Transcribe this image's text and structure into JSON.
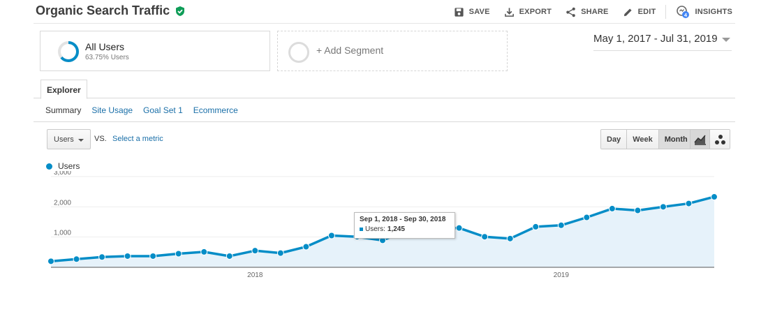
{
  "header": {
    "title": "Organic Search Traffic",
    "actions": [
      {
        "label": "SAVE",
        "icon": "save-icon"
      },
      {
        "label": "EXPORT",
        "icon": "export-icon"
      },
      {
        "label": "SHARE",
        "icon": "share-icon"
      },
      {
        "label": "EDIT",
        "icon": "edit-icon"
      },
      {
        "label": "INSIGHTS",
        "icon": "insights-icon",
        "badge": "4"
      }
    ]
  },
  "segments": {
    "active": {
      "name": "All Users",
      "share": "63.75% Users"
    },
    "add_label": "+ Add Segment"
  },
  "date_range": "May 1, 2017 - Jul 31, 2019",
  "tabs": {
    "main": "Explorer",
    "sub": [
      "Summary",
      "Site Usage",
      "Goal Set 1",
      "Ecommerce"
    ],
    "active_sub": 0
  },
  "metric": {
    "selected": "Users",
    "vs": "VS.",
    "select_label": "Select a metric"
  },
  "periods": {
    "items": [
      "Day",
      "Week",
      "Month"
    ],
    "active": 2
  },
  "legend": "Users",
  "tooltip": {
    "title": "Sep 1, 2018 - Sep 30, 2018",
    "label": "Users:",
    "value": "1,245"
  },
  "colors": {
    "series": "#058dc7",
    "fill": "#e6f2fa",
    "verified": "#0f9d58"
  },
  "chart_data": {
    "type": "area",
    "x": [
      "2017-05",
      "2017-06",
      "2017-07",
      "2017-08",
      "2017-09",
      "2017-10",
      "2017-11",
      "2017-12",
      "2018-01",
      "2018-02",
      "2018-03",
      "2018-04",
      "2018-05",
      "2018-06",
      "2018-07",
      "2018-08",
      "2018-09",
      "2018-10",
      "2018-11",
      "2018-12",
      "2019-01",
      "2019-02",
      "2019-03",
      "2019-04",
      "2019-05",
      "2019-06",
      "2019-07"
    ],
    "series": [
      {
        "name": "Users",
        "values": [
          200,
          270,
          340,
          370,
          370,
          450,
          510,
          370,
          550,
          470,
          680,
          1050,
          1010,
          890,
          1240,
          1280,
          1300,
          1010,
          950,
          1340,
          1390,
          1650,
          1940,
          1880,
          2000,
          2110,
          2330
        ]
      }
    ],
    "ylim": [
      0,
      3000
    ],
    "yticks": [
      1000,
      2000,
      3000
    ],
    "ytick_labels": [
      "1,000",
      "2,000",
      "3,000"
    ],
    "xtick_labels": [
      "2018",
      "2019"
    ],
    "grid": true,
    "legend_position": "top-left"
  }
}
